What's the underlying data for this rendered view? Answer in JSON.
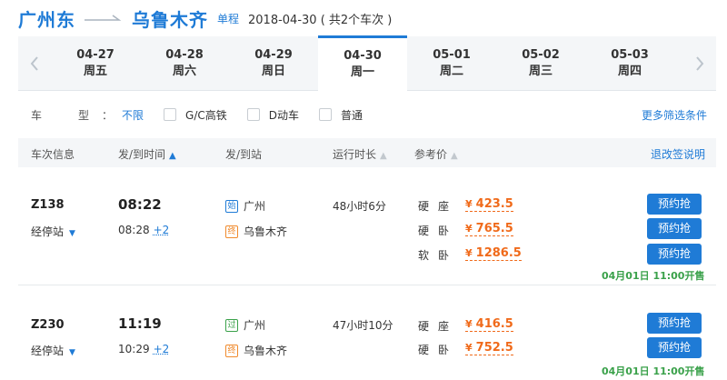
{
  "route": {
    "from": "广州东",
    "to": "乌鲁木齐",
    "trip_type": "单程",
    "date_summary": "2018-04-30 ( 共2个车次 )"
  },
  "date_nav": {
    "prev_icon": "chevron-left-icon",
    "next_icon": "chevron-right-icon",
    "days": [
      {
        "date": "04-27",
        "weekday": "周五",
        "active": false
      },
      {
        "date": "04-28",
        "weekday": "周六",
        "active": false
      },
      {
        "date": "04-29",
        "weekday": "周日",
        "active": false
      },
      {
        "date": "04-30",
        "weekday": "周一",
        "active": true
      },
      {
        "date": "05-01",
        "weekday": "周二",
        "active": false
      },
      {
        "date": "05-02",
        "weekday": "周三",
        "active": false
      },
      {
        "date": "05-03",
        "weekday": "周四",
        "active": false
      }
    ]
  },
  "filters": {
    "type_label": "车　型：",
    "type_value": "不限",
    "options": [
      "G/C高铁",
      "D动车",
      "普通"
    ],
    "more_link": "更多筛选条件"
  },
  "table_header": {
    "train_info": "车次信息",
    "dep_arr_time": "发/到时间",
    "dep_arr_station": "发/到站",
    "duration": "运行时长",
    "price": "参考价",
    "refund_help": "退改签说明"
  },
  "trains": [
    {
      "code": "Z138",
      "stops_label": "经停站",
      "dep_time": "08:22",
      "arr_time": "08:28",
      "day_offset": "+2",
      "from_tag": "始",
      "from_station": "广州",
      "to_tag": "终",
      "to_station": "乌鲁木齐",
      "duration": "48小时6分",
      "seats": [
        {
          "name": "硬座",
          "price": "423.5"
        },
        {
          "name": "硬卧",
          "price": "765.5"
        },
        {
          "name": "软卧",
          "price": "1286.5"
        }
      ],
      "book_label": "预约抢",
      "sale_note": "04月01日 11:00开售"
    },
    {
      "code": "Z230",
      "stops_label": "经停站",
      "dep_time": "11:19",
      "arr_time": "10:29",
      "day_offset": "+2",
      "from_tag": "过",
      "from_station": "广州",
      "to_tag": "终",
      "to_station": "乌鲁木齐",
      "duration": "47小时10分",
      "seats": [
        {
          "name": "硬座",
          "price": "416.5"
        },
        {
          "name": "硬卧",
          "price": "752.5"
        }
      ],
      "book_label": "预约抢",
      "sale_note": "04月01日 11:00开售"
    }
  ],
  "currency": "¥",
  "colors": {
    "accent": "#1f7bd6",
    "price": "#f06a1a",
    "sale": "#3aa14a"
  }
}
